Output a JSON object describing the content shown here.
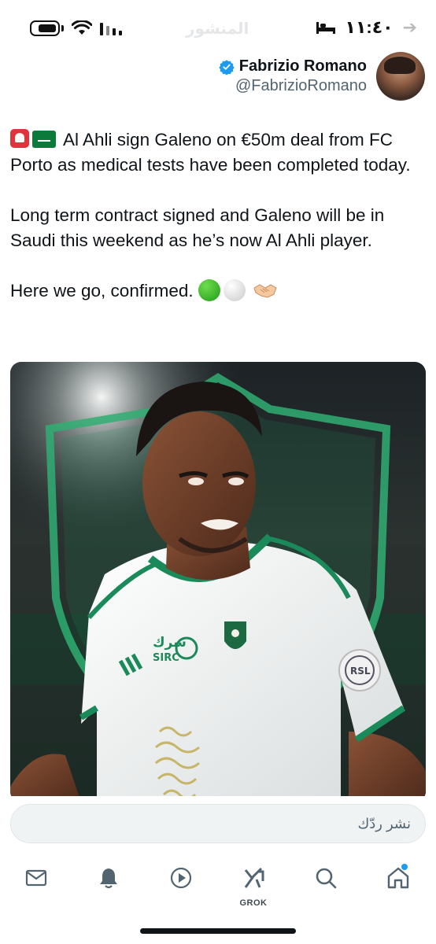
{
  "status_bar": {
    "time": "١١:٤٠",
    "faded_header": "المنشور"
  },
  "author": {
    "name": "Fabrizio Romano",
    "handle": "@FabrizioRomano",
    "verified_icon": "verified-badge-icon",
    "verified_color": "#1d9bf0"
  },
  "tweet": {
    "para1": "Al Ahli sign Galeno on €50m deal from FC Porto as medical tests have been completed today.",
    "para2": "Long term contract signed and Galeno will be in Saudi this weekend as he’s now Al Ahli player.",
    "para3": "Here we go, confirmed.",
    "emojis": [
      "siren-icon",
      "saudi-flag-icon",
      "green-circle-icon",
      "white-circle-icon",
      "handshake-icon"
    ]
  },
  "media": {
    "sponsor_text": "سرك",
    "sponsor_sub": "SIRC",
    "badge_text": "RSL",
    "accent": "#1b8a5a"
  },
  "reply": {
    "placeholder": "نشر ردّك"
  },
  "nav": {
    "grok_label": "GROK",
    "items": [
      "messages-icon",
      "notifications-icon",
      "video-icon",
      "grok-icon",
      "search-icon",
      "home-icon"
    ],
    "dot_color": "#1d9bf0"
  }
}
